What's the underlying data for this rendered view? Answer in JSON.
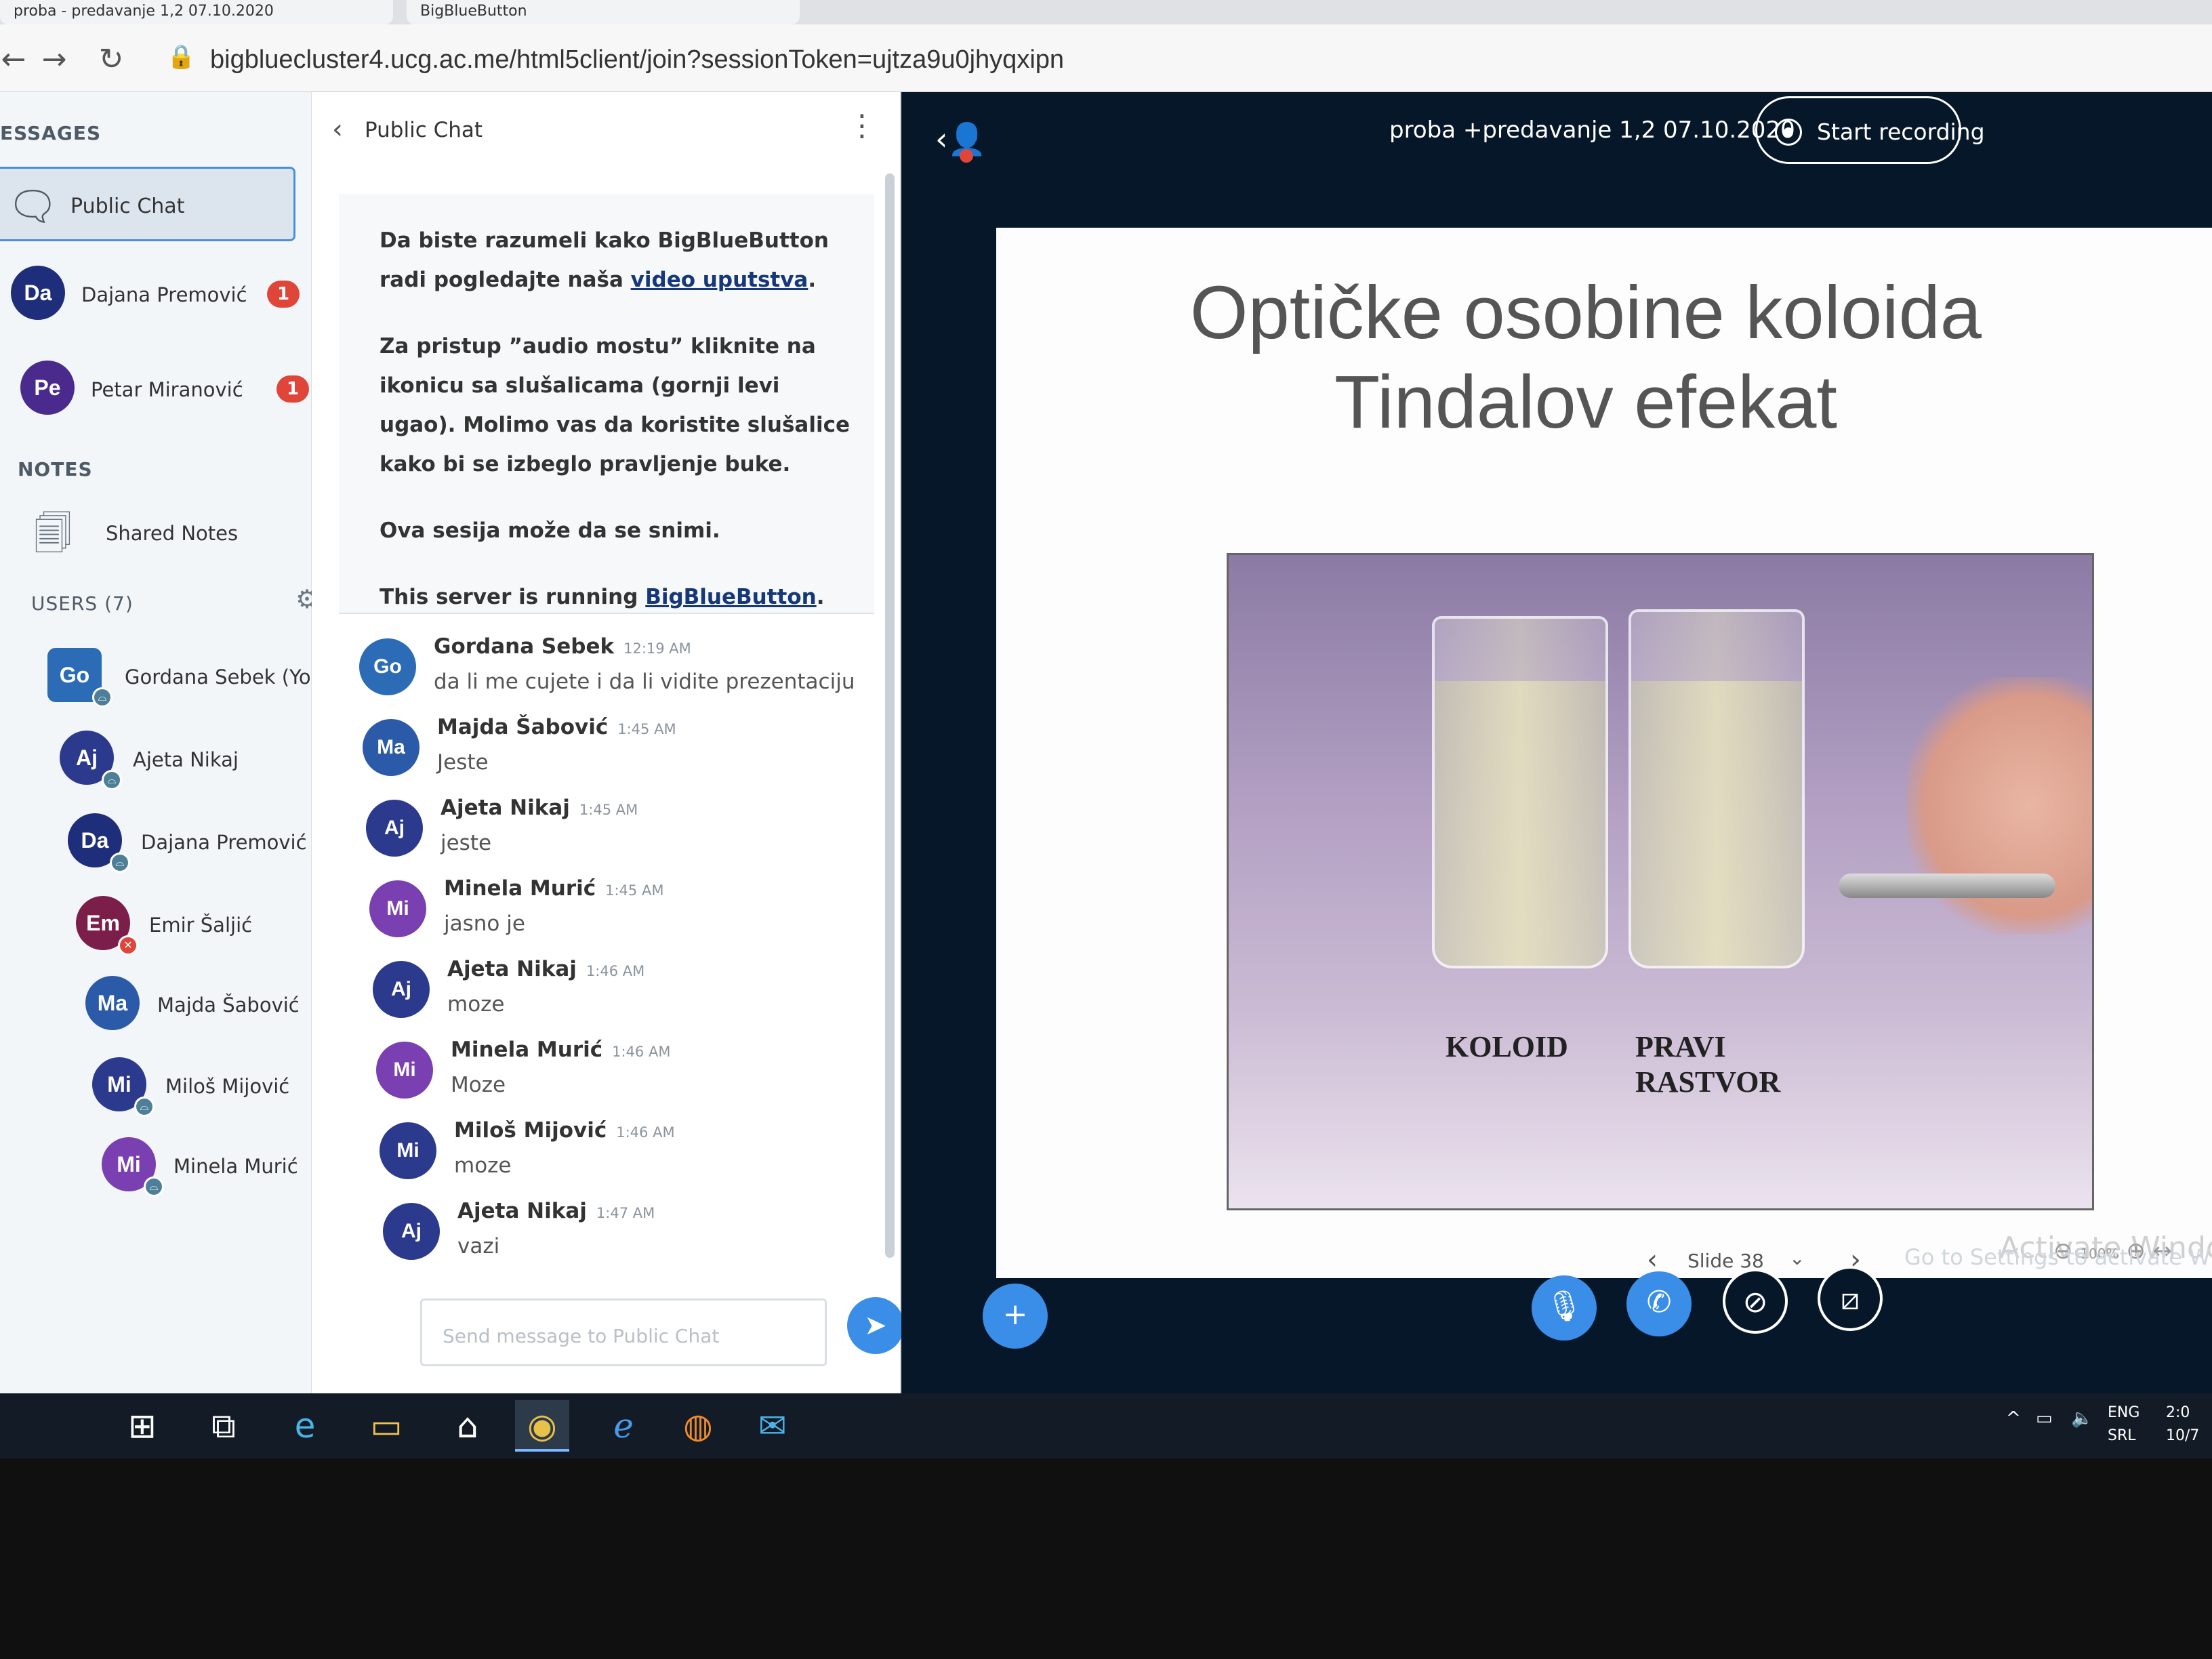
{
  "browser": {
    "tabs": [
      "proba - predavanje 1,2 07.10.2020",
      "BigBlueButton"
    ],
    "url": "bigbluecluster4.ucg.ac.me/html5client/join?sessionToken=ujtza9u0jhyqxipn"
  },
  "sidebar": {
    "messages_title": "ESSAGES",
    "public_chat_label": "Public Chat",
    "private_chats": [
      {
        "initials": "Da",
        "name": "Dajana Premović",
        "unread": "1",
        "color": "#1f2e7a"
      },
      {
        "initials": "Pe",
        "name": "Petar Miranović",
        "unread": "1",
        "color": "#4a2a8c"
      }
    ],
    "notes_title": "NOTES",
    "shared_notes_label": "Shared Notes",
    "users_title": "USERS (7)",
    "users": [
      {
        "initials": "Go",
        "name": "Gordana Sebek (You)",
        "color": "#2c6bb5"
      },
      {
        "initials": "Aj",
        "name": "Ajeta Nikaj",
        "color": "#2b3a8c"
      },
      {
        "initials": "Da",
        "name": "Dajana Premović",
        "color": "#1f2e7a"
      },
      {
        "initials": "Em",
        "name": "Emir Šaljić",
        "color": "#7b1f4a"
      },
      {
        "initials": "Ma",
        "name": "Majda Šabović",
        "color": "#2b5aa8"
      },
      {
        "initials": "Mi",
        "name": "Miloš Mijović",
        "color": "#2b3a8c"
      },
      {
        "initials": "Mi",
        "name": "Minela Murić",
        "color": "#7a3fb0"
      }
    ]
  },
  "chat": {
    "title": "Public Chat",
    "welcome": {
      "p1_pre": "Da biste razumeli kako BigBlueButton radi pogledajte naša ",
      "p1_link": "video uputstva",
      "p1_post": ".",
      "p2": "Za pristup ”audio mostu” kliknite na ikonicu sa slušalicama (gornji levi ugao). Molimo vas da koristite slušalice kako bi se izbeglo pravljenje buke.",
      "p3": "Ova sesija može da se snimi.",
      "p4_pre": "This server is running ",
      "p4_link": "BigBlueButton",
      "p4_post": "."
    },
    "messages": [
      {
        "initials": "Go",
        "sender": "Gordana Sebek",
        "time": "12:19 AM",
        "text": "da li me cujete i da li vidite prezentaciju",
        "color": "#2c6bb5"
      },
      {
        "initials": "Ma",
        "sender": "Majda Šabović",
        "time": "1:45 AM",
        "text": "Jeste",
        "color": "#2b5aa8"
      },
      {
        "initials": "Aj",
        "sender": "Ajeta Nikaj",
        "time": "1:45 AM",
        "text": "jeste",
        "color": "#2b3a8c"
      },
      {
        "initials": "Mi",
        "sender": "Minela Murić",
        "time": "1:45 AM",
        "text": "jasno je",
        "color": "#7a3fb0"
      },
      {
        "initials": "Aj",
        "sender": "Ajeta Nikaj",
        "time": "1:46 AM",
        "text": "moze",
        "color": "#2b3a8c"
      },
      {
        "initials": "Mi",
        "sender": "Minela Murić",
        "time": "1:46 AM",
        "text": "Moze",
        "color": "#7a3fb0"
      },
      {
        "initials": "Mi",
        "sender": "Miloš Mijović",
        "time": "1:46 AM",
        "text": "moze",
        "color": "#2b3a8c"
      },
      {
        "initials": "Aj",
        "sender": "Ajeta Nikaj",
        "time": "1:47 AM",
        "text": "vazi",
        "color": "#2b3a8c"
      }
    ],
    "input_placeholder": "Send message to Public Chat"
  },
  "main": {
    "meeting_title": "proba +predavanje 1,2 07.10.2020",
    "record_label": "Start recording",
    "slide": {
      "title_line1": "Optičke osobine koloida",
      "title_line2": "Tindalov efekat",
      "label_left": "KOLOID",
      "label_right_1": "PRAVI",
      "label_right_2": "RASTVOR"
    },
    "slide_nav": {
      "label": "Slide 38"
    },
    "zoom": "100%",
    "watermark_title": "Activate Windows",
    "watermark_sub": "Go to Settings to activate Wind"
  },
  "taskbar": {
    "lang1": "ENG",
    "lang2": "SRL",
    "time": "2:0",
    "date": "10/7"
  }
}
